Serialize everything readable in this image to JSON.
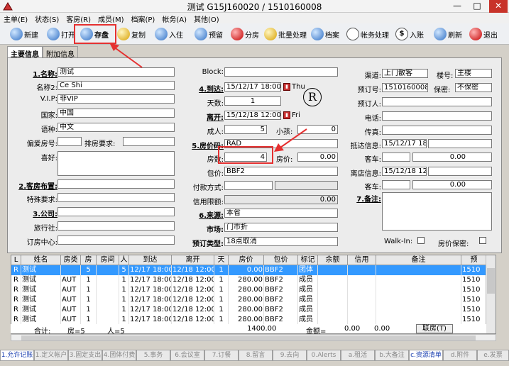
{
  "window": {
    "title": "测试 G15J160020 / 1510160008",
    "min": "—",
    "max": "□",
    "close": "✕"
  },
  "menu": [
    "主单(E)",
    "状态(S)",
    "客房(R)",
    "成员(M)",
    "档案(P)",
    "帐务(A)",
    "其他(O)"
  ],
  "toolbar": {
    "new": "新建",
    "open": "打开",
    "save": "存盘",
    "copy": "复制",
    "checkin": "入住",
    "reserve": "预留",
    "assign": "分房",
    "batch": "批量处理",
    "profile": "档案",
    "account": "帐务处理",
    "post": "入账",
    "refresh": "刷新",
    "exit": "退出",
    "post_glyph": "$"
  },
  "tabs": {
    "main": "主要信息",
    "extra": "附加信息"
  },
  "form": {
    "name_label": "1.名称:",
    "name": "测试",
    "name2_label": "名称2:",
    "name2": "Ce Shi",
    "vip_label": "V.I.P:",
    "vip": "非VIP",
    "country_label": "国家:",
    "country": "中国",
    "lang_label": "语种:",
    "lang": "中文",
    "prefroom_label": "偏爱房号:",
    "queue_label": "排房要求:",
    "like_label": "喜好:",
    "layout_label": "2.客房布置:",
    "special_label": "特殊要求:",
    "company_label": "3.公司:",
    "agency_label": "旅行社:",
    "center_label": "订房中心:",
    "block_label": "Block:",
    "arrive_label": "4.到达:",
    "arrive": "15/12/17 18:00",
    "arrive_day": "Thu",
    "days_label": "天数:",
    "days": "1",
    "depart_label": "离开:",
    "depart": "15/12/18 12:00",
    "depart_day": "Fri",
    "adult_label": "成人:",
    "adult": "5",
    "child_label": "小孩:",
    "child": "0",
    "rate_label": "5.房价码:",
    "rate": "RAD",
    "rooms_label": "房数:",
    "rooms": "4",
    "price_label": "房价:",
    "price": "0.00",
    "package_label": "包价:",
    "package": "BBF2",
    "pay_label": "付款方式:",
    "credit_label": "信用限额:",
    "credit": "0.00",
    "source_label": "6.来源:",
    "source": "本省",
    "market_label": "市场:",
    "market": "门市折",
    "restype_label": "预订类型:",
    "restype": "18点取消",
    "channel_label": "渠道:",
    "channel": "上门散客",
    "building_label": "楼号:",
    "building": "主楼",
    "resno_label": "预订号:",
    "resno": "1510160008",
    "secret_label": "保密:",
    "secret": "不保密",
    "booker_label": "预订人:",
    "phone_label": "电话:",
    "fax_label": "传真:",
    "arrinfo_label": "抵达信息:",
    "arrinfo": "15/12/17 18:",
    "car1_label": "客车:",
    "car1": "0.00",
    "depinfo_label": "离店信息:",
    "depinfo": "15/12/18 12:",
    "car2_label": "客车:",
    "car2": "0.00",
    "remark_label": "7.备注:",
    "walkin_label": "Walk-In:",
    "pricesecret_label": "房价保密:",
    "r_badge": "R"
  },
  "grid": {
    "headers": [
      "L",
      "姓名",
      "房类",
      "房",
      "房间",
      "人",
      "到达",
      "离开",
      "天",
      "房价",
      "包价",
      "标记",
      "余额",
      "信用",
      "备注",
      "预"
    ],
    "rows": [
      [
        "R",
        "测试",
        "",
        "5",
        "",
        "5",
        "12/17 18:00",
        "12/18 12:00",
        "1",
        "0.00",
        "BBF2",
        "团体",
        "",
        "",
        "",
        "1510"
      ],
      [
        "R",
        "测试",
        "AUT",
        "1",
        "",
        "1",
        "12/17 18:00",
        "12/18 12:00",
        "1",
        "280.00",
        "BBF2",
        "成员",
        "",
        "",
        "",
        "1510"
      ],
      [
        "R",
        "测试",
        "AUT",
        "1",
        "",
        "1",
        "12/17 18:00",
        "12/18 12:00",
        "1",
        "280.00",
        "BBF2",
        "成员",
        "",
        "",
        "",
        "1510"
      ],
      [
        "R",
        "测试",
        "AUT",
        "1",
        "",
        "1",
        "12/17 18:00",
        "12/18 12:00",
        "1",
        "280.00",
        "BBF2",
        "成员",
        "",
        "",
        "",
        "1510"
      ],
      [
        "R",
        "测试",
        "AUT",
        "1",
        "",
        "1",
        "12/17 18:00",
        "12/18 12:00",
        "1",
        "280.00",
        "BBF2",
        "成员",
        "",
        "",
        "",
        "1510"
      ],
      [
        "R",
        "测试",
        "AUT",
        "1",
        "",
        "1",
        "12/17 18:00",
        "12/18 12:00",
        "1",
        "280.00",
        "BBF2",
        "成员",
        "",
        "",
        "",
        "1510"
      ]
    ],
    "summary": {
      "total": "合计:",
      "rooms": "房=5",
      "persons": "人=5",
      "price": "1400.00",
      "amount": "金额=",
      "amt1": "0.00",
      "amt2": "0.00"
    },
    "lianfang": "联房(T)"
  },
  "bottom_tabs": [
    "1.允许记账",
    "1.定义帐户",
    "3.固定支出",
    "4.团体付费",
    "5.事务",
    "6.会议室",
    "7.订餐",
    "8.留言",
    "9.去向",
    "0.Alerts",
    "a.租活",
    "b.大备注",
    "c.资源清单",
    "d.附件",
    "e.发票"
  ],
  "colors": {
    "highlight": "#e53030",
    "selection": "#3399ff",
    "active_tab_text": "#1a3fb0"
  }
}
